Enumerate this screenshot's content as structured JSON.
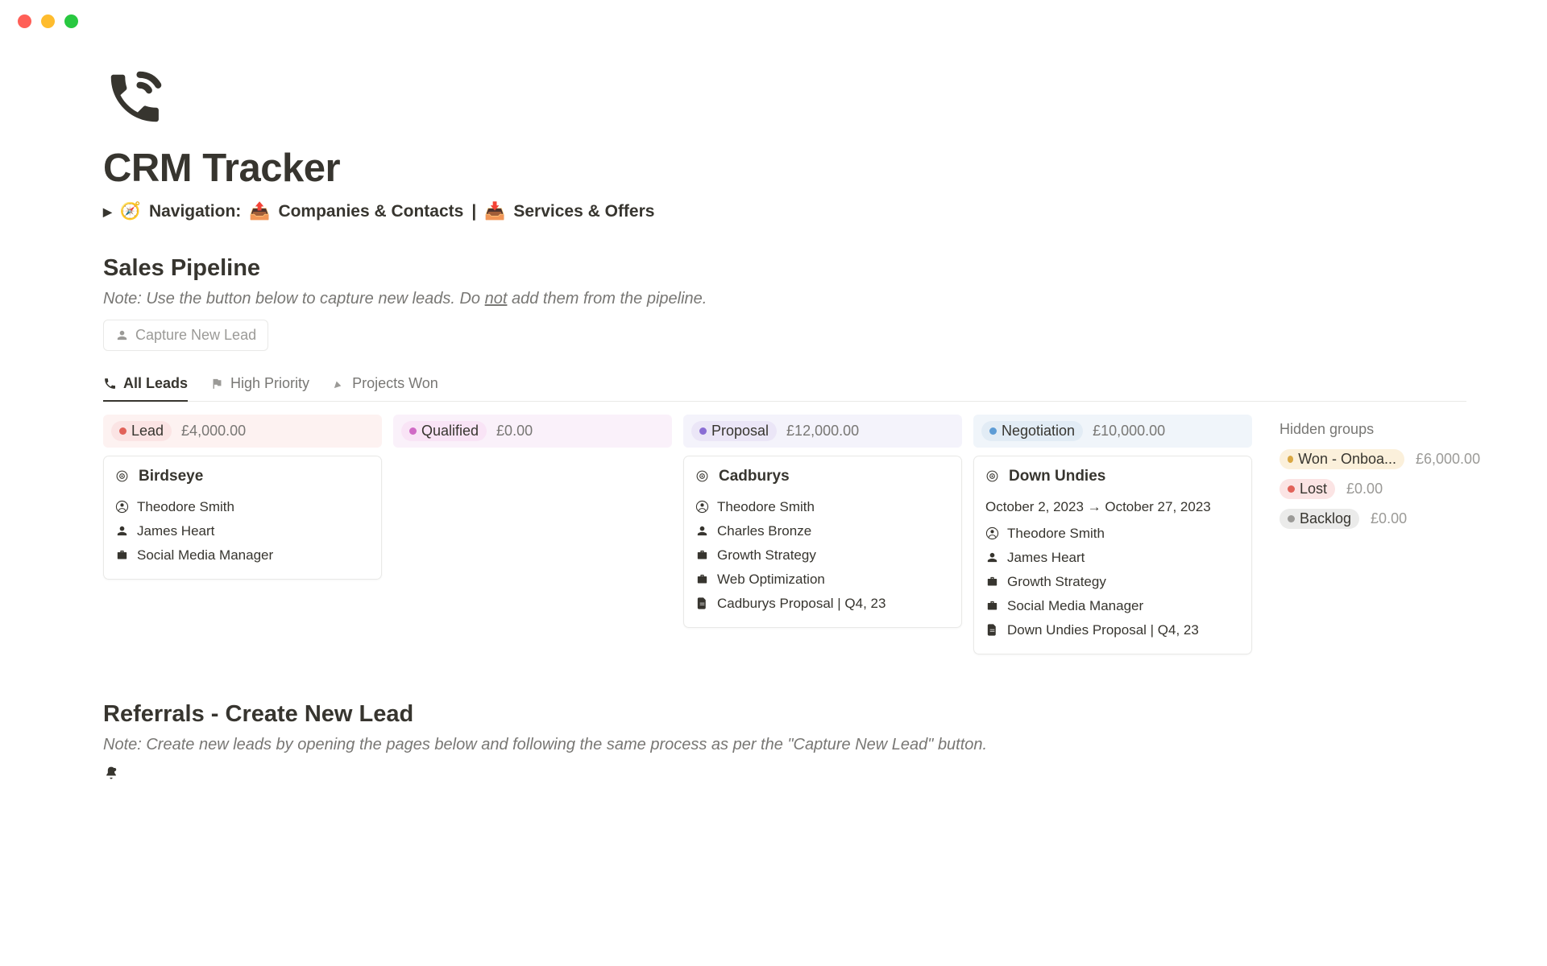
{
  "page": {
    "title": "CRM Tracker",
    "navigation_label": "Navigation:",
    "nav_link_1": "Companies & Contacts",
    "nav_divider": "|",
    "nav_link_2": "Services & Offers"
  },
  "sales": {
    "heading": "Sales Pipeline",
    "note_prefix": "Note: Use the button below to capture new leads. Do ",
    "note_underlined": "not",
    "note_suffix": " add them from the pipeline.",
    "capture_label": "Capture New Lead"
  },
  "tabs": {
    "all_leads": "All Leads",
    "high_priority": "High Priority",
    "projects_won": "Projects Won"
  },
  "columns": {
    "lead": {
      "name": "Lead",
      "amount": "£4,000.00"
    },
    "qualified": {
      "name": "Qualified",
      "amount": "£0.00"
    },
    "proposal": {
      "name": "Proposal",
      "amount": "£12,000.00"
    },
    "negotiation": {
      "name": "Negotiation",
      "amount": "£10,000.00"
    }
  },
  "cards": {
    "birdseye": {
      "title": "Birdseye",
      "contact": "Theodore Smith",
      "owner": "James Heart",
      "service": "Social Media Manager"
    },
    "cadburys": {
      "title": "Cadburys",
      "contact": "Theodore Smith",
      "owner": "Charles Bronze",
      "service_1": "Growth Strategy",
      "service_2": "Web Optimization",
      "doc": "Cadburys Proposal | Q4, 23"
    },
    "down_undies": {
      "title": "Down Undies",
      "date_range": "October 2, 2023 → October 27, 2023",
      "contact": "Theodore Smith",
      "owner": "James Heart",
      "service_1": "Growth Strategy",
      "service_2": "Social Media Manager",
      "doc": "Down Undies Proposal | Q4, 23"
    }
  },
  "hidden": {
    "title": "Hidden groups",
    "won": {
      "label": "Won - Onboa...",
      "amount": "£6,000.00"
    },
    "lost": {
      "label": "Lost",
      "amount": "£0.00"
    },
    "backlog": {
      "label": "Backlog",
      "amount": "£0.00"
    }
  },
  "referrals": {
    "heading": "Referrals - Create New Lead",
    "note": "Note: Create new leads by opening the pages below and following the same process as per the \"Capture New Lead\" button."
  }
}
